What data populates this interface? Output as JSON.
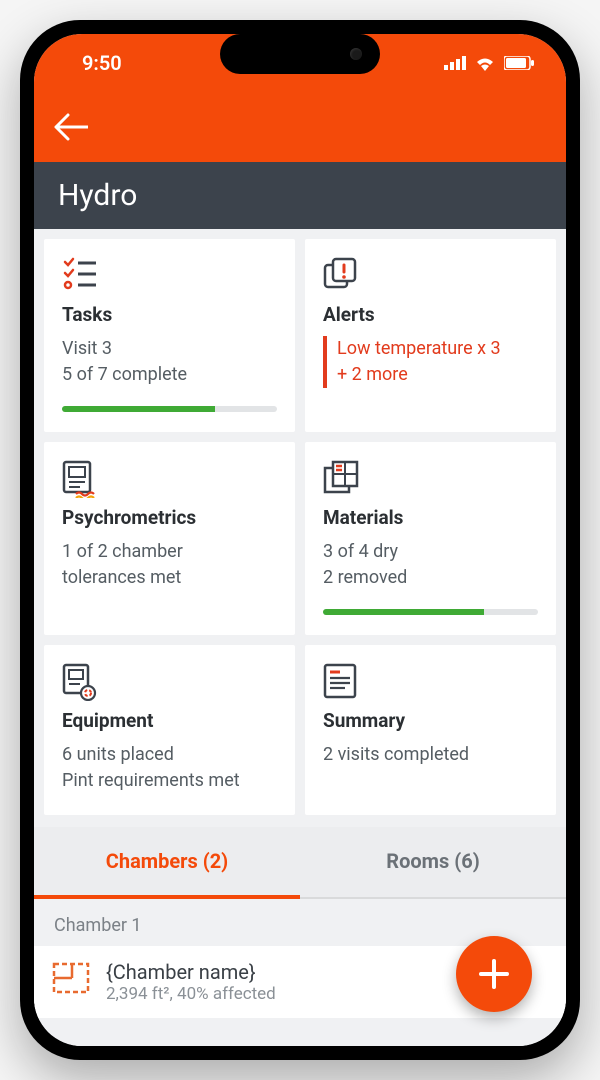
{
  "status": {
    "time": "9:50"
  },
  "page_title": "Hydro",
  "cards": {
    "tasks": {
      "title": "Tasks",
      "line1": "Visit 3",
      "line2": "5 of 7 complete",
      "progress_pct": 71
    },
    "alerts": {
      "title": "Alerts",
      "line1": "Low temperature x 3",
      "line2": "+ 2 more"
    },
    "psychro": {
      "title": "Psychrometrics",
      "line1": "1 of 2 chamber",
      "line2": "tolerances met"
    },
    "materials": {
      "title": "Materials",
      "line1": "3 of 4 dry",
      "line2": "2 removed",
      "progress_pct": 75
    },
    "equipment": {
      "title": "Equipment",
      "line1": "6 units placed",
      "line2": "Pint requirements met"
    },
    "summary": {
      "title": "Summary",
      "line1": "2 visits completed"
    }
  },
  "tabs": {
    "chambers": "Chambers (2)",
    "rooms": "Rooms (6)"
  },
  "list": {
    "section": "Chamber 1",
    "item": {
      "name": "{Chamber name}",
      "meta": "2,394 ft², 40% affected"
    }
  },
  "colors": {
    "accent": "#f44a0a",
    "alert": "#e23b1d",
    "green": "#3faa35"
  }
}
